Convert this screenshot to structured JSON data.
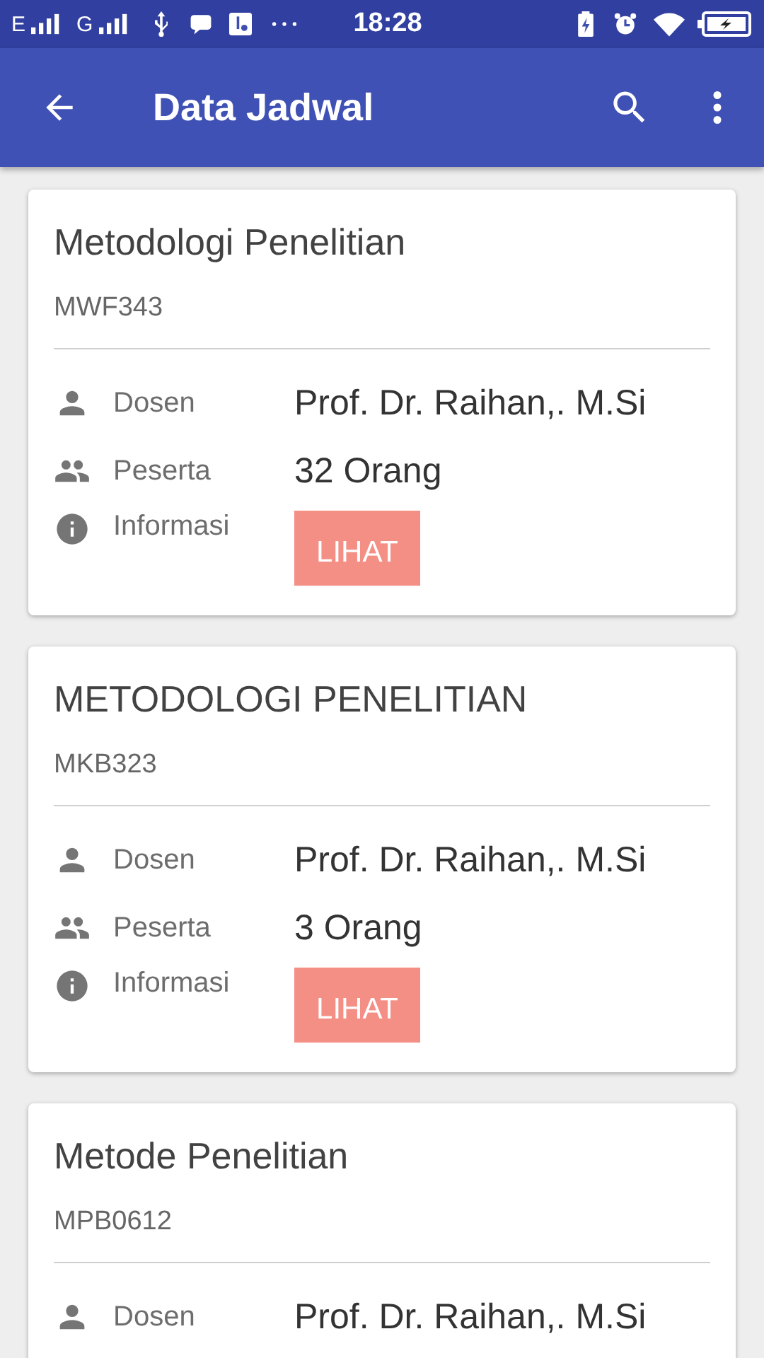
{
  "status_bar": {
    "network_1": "E",
    "network_2": "G",
    "time": "18:28"
  },
  "app_bar": {
    "title": "Data Jadwal"
  },
  "cards": [
    {
      "title": "Metodologi Penelitian",
      "code": "MWF343",
      "rows": [
        {
          "kind": "dosen",
          "label": "Dosen",
          "value": "Prof. Dr. Raihan,. M.Si"
        },
        {
          "kind": "peserta",
          "label": "Peserta",
          "value": "32 Orang"
        },
        {
          "kind": "info",
          "label": "Informasi",
          "button": "LIHAT"
        }
      ]
    },
    {
      "title": "METODOLOGI PENELITIAN",
      "code": "MKB323",
      "rows": [
        {
          "kind": "dosen",
          "label": "Dosen",
          "value": "Prof. Dr. Raihan,. M.Si"
        },
        {
          "kind": "peserta",
          "label": "Peserta",
          "value": "3 Orang"
        },
        {
          "kind": "info",
          "label": "Informasi",
          "button": "LIHAT"
        }
      ]
    },
    {
      "title": "Metode Penelitian",
      "code": "MPB0612",
      "rows": [
        {
          "kind": "dosen",
          "label": "Dosen",
          "value": "Prof. Dr. Raihan,. M.Si"
        }
      ]
    }
  ]
}
